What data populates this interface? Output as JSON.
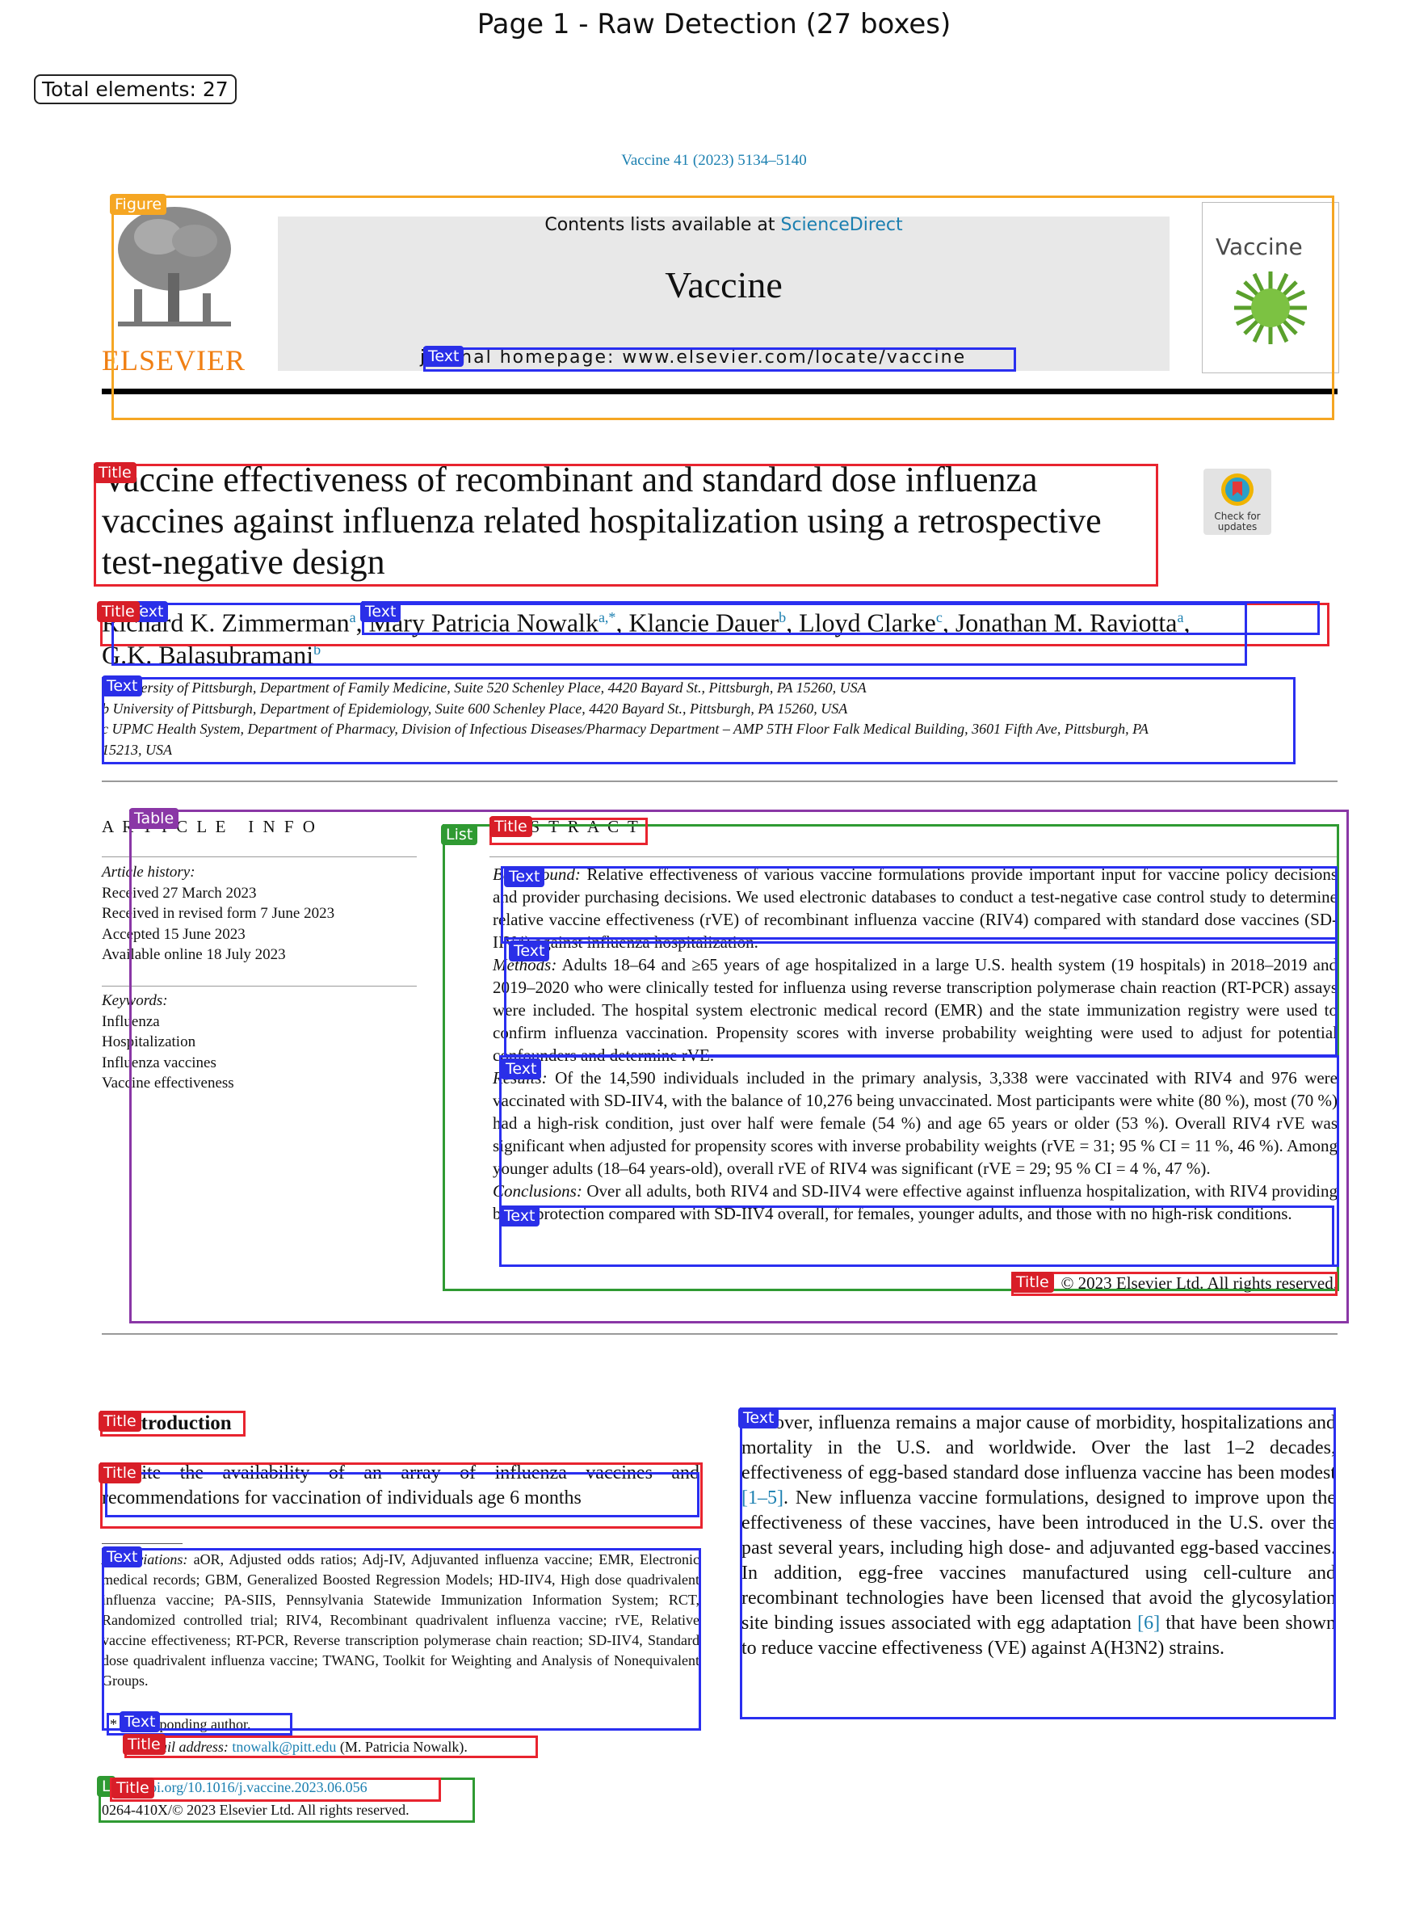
{
  "header": {
    "title": "Page 1 - Raw Detection (27 boxes)",
    "total_label": "Total elements: 27"
  },
  "journal": {
    "citation": "Vaccine 41 (2023) 5134–5140",
    "contents_prefix": "Contents lists available at ",
    "contents_link": "ScienceDirect",
    "name": "Vaccine",
    "homepage": "journal homepage: www.elsevier.com/locate/vaccine",
    "publisher": "ELSEVIER",
    "cover_title": "Vaccine",
    "check_updates": "Check for updates"
  },
  "article": {
    "title_lines": [
      "Vaccine effectiveness of recombinant and standard dose influenza",
      "vaccines against influenza related hospitalization using a retrospective",
      "test-negative design"
    ],
    "authors_line1": "Richard K. Zimmerman",
    "authors_line1_sup": "a",
    "author2": "Mary Patricia Nowalk",
    "author2_sup": "a,*",
    "author3": "Klancie Dauer",
    "author3_sup": "b",
    "author4": "Lloyd Clarke",
    "author4_sup": "c",
    "author5": "Jonathan M. Raviotta",
    "author5_sup": "a",
    "author6": "G.K. Balasubramani",
    "author6_sup": "b",
    "affiliations": [
      "a University of Pittsburgh, Department of Family Medicine, Suite 520 Schenley Place, 4420 Bayard St., Pittsburgh, PA 15260, USA",
      "b University of Pittsburgh, Department of Epidemiology, Suite 600 Schenley Place, 4420 Bayard St., Pittsburgh, PA 15260, USA",
      "c UPMC Health System, Department of Pharmacy, Division of Infectious Diseases/Pharmacy Department – AMP 5TH Floor Falk Medical Building, 3601 Fifth Ave, Pittsburgh, PA",
      "15213, USA"
    ]
  },
  "info": {
    "heading": "A R T I C L E   I N F O",
    "history_label": "Article history:",
    "history": [
      "Received 27 March 2023",
      "Received in revised form 7 June 2023",
      "Accepted 15 June 2023",
      "Available online 18 July 2023"
    ],
    "keywords_label": "Keywords:",
    "keywords": [
      "Influenza",
      "Hospitalization",
      "Influenza vaccines",
      "Vaccine effectiveness"
    ]
  },
  "abstract": {
    "heading": "A B S T R A C T",
    "background_label": "Background:",
    "background": " Relative effectiveness of various vaccine formulations provide important input for vaccine policy decisions and provider purchasing decisions. We used electronic databases to conduct a test-negative case control study to determine relative vaccine effectiveness (rVE) of recombinant influenza vaccine (RIV4) compared with standard dose vaccines (SD-IIV4) against influenza hospitalization.",
    "methods_label": "Methods:",
    "methods": " Adults 18–64 and ≥65 years of age hospitalized in a large U.S. health system (19 hospitals) in 2018–2019 and 2019–2020 who were clinically tested for influenza using reverse transcription polymerase chain reaction (RT-PCR) assays were included. The hospital system electronic medical record (EMR) and the state immunization registry were used to confirm influenza vaccination. Propensity scores with inverse probability weighting were used to adjust for potential confounders and determine rVE.",
    "results_label": "Results:",
    "results": " Of the 14,590 individuals included in the primary analysis, 3,338 were vaccinated with RIV4 and 976 were vaccinated with SD-IIV4, with the balance of 10,276 being unvaccinated. Most participants were white (80 %), most (70 %) had a high-risk condition, just over half were female (54 %) and age 65 years or older (53 %). Overall RIV4 rVE was significant when adjusted for propensity scores with inverse probability weights (rVE = 31; 95 % CI = 11 %, 46 %). Among younger adults (18–64 years-old), overall rVE of RIV4 was significant (rVE = 29; 95 % CI = 4 %, 47 %).",
    "conclusions_label": "Conclusions:",
    "conclusions": " Over all adults, both RIV4 and SD-IIV4 were effective against influenza hospitalization, with RIV4 providing better protection compared with SD-IIV4 overall, for females, younger adults, and those with no high-risk conditions.",
    "copyright": "© 2023 Elsevier Ltd. All rights reserved."
  },
  "intro": {
    "heading": "1. Introduction",
    "para_left": "Despite the availability of an array of influenza vaccines and recommendations for vaccination of individuals age 6 months",
    "para_right_1": "and over, influenza remains a major cause of morbidity, hospitalizations and mortality in the U.S. and worldwide. Over the last 1–2 decades, effectiveness of egg-based standard dose influenza vaccine has been modest ",
    "ref1": "[1–5]",
    "para_right_2": ". New influenza vaccine formulations, designed to improve upon the effectiveness of these vaccines, have been introduced in the U.S. over the past several years, including high dose- and adjuvanted egg-based vaccines. In addition, egg-free vaccines manufactured using cell-culture and recombinant technologies have been licensed that avoid the glycosylation site binding issues associated with egg adaptation ",
    "ref2": "[6]",
    "para_right_3": " that have been shown to reduce vaccine effectiveness (VE) against A(H3N2) strains."
  },
  "footnotes": {
    "abbrev_label": "Abbreviations:",
    "abbrev": " aOR, Adjusted odds ratios; Adj-IV, Adjuvanted influenza vaccine; EMR, Electronic medical records; GBM, Generalized Boosted Regression Models; HD-IIV4, High dose quadrivalent influenza vaccine; PA-SIIS, Pennsylvania Statewide Immunization Information System; RCT, Randomized controlled trial; RIV4, Recombinant quadrivalent influenza vaccine; rVE, Relative vaccine effectiveness; RT-PCR, Reverse transcription polymerase chain reaction; SD-IIV4, Standard dose quadrivalent influenza vaccine; TWANG, Toolkit for Weighting and Analysis of Nonequivalent Groups.",
    "corresponding": "* Corresponding author.",
    "email_label": "E-mail address:",
    "email": "tnowalk@pitt.edu",
    "email_name": " (M. Patricia Nowalk).",
    "doi": "https://doi.org/10.1016/j.vaccine.2023.06.056",
    "issn": "0264-410X/© 2023 Elsevier Ltd. All rights reserved."
  },
  "labels": {
    "figure": "Figure",
    "text": "Text",
    "title": "Title",
    "table": "Table",
    "list": "List",
    "list_short": "L"
  }
}
